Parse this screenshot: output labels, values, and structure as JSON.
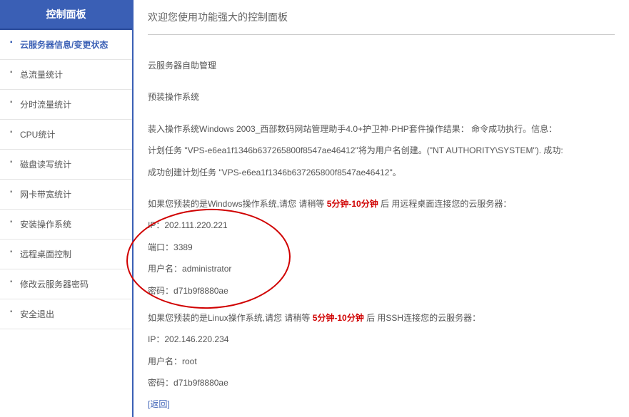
{
  "sidebar": {
    "header": "控制面板",
    "items": [
      {
        "label": "云服务器信息/变更状态"
      },
      {
        "label": "总流量统计"
      },
      {
        "label": "分时流量统计"
      },
      {
        "label": "CPU统计"
      },
      {
        "label": "磁盘读写统计"
      },
      {
        "label": "网卡带宽统计"
      },
      {
        "label": "安装操作系统"
      },
      {
        "label": "远程桌面控制"
      },
      {
        "label": "修改云服务器密码"
      },
      {
        "label": "安全退出"
      }
    ]
  },
  "main": {
    "welcome": "欢迎您使用功能强大的控制面板",
    "title": "云服务器自助管理",
    "subtitle": "预装操作系统",
    "install_msg_1": "装入操作系统Windows 2003_西部数码网站管理助手4.0+护卫神·PHP套件操作结果： 命令成功执行。信息：",
    "install_msg_2": "计划任务 \"VPS-e6ea1f1346b637265800f8547ae46412\"将为用户名创建。(\"NT AUTHORITY\\SYSTEM\"). 成功:",
    "install_msg_3": "成功创建计划任务 \"VPS-e6ea1f1346b637265800f8547ae46412\"。",
    "win_pre": "如果您预装的是Windows操作系统,请您 请稍等 ",
    "wait_time": "5分钟-10分钟",
    "win_post": " 后 用远程桌面连接您的云服务器：",
    "win_ip_label": "IP：",
    "win_ip": "202.111.220.221",
    "port_label": "端口：",
    "port": "3389",
    "user_label": "用户名：",
    "win_user": "administrator",
    "pwd_label": "密码：",
    "win_pwd": "d71b9f8880ae",
    "linux_pre": "如果您预装的是Linux操作系统,请您 请稍等 ",
    "linux_post": " 后 用SSH连接您的云服务器：",
    "linux_ip": "202.146.220.234",
    "linux_user": "root",
    "linux_pwd": "d71b9f8880ae",
    "back": "[返回]"
  }
}
